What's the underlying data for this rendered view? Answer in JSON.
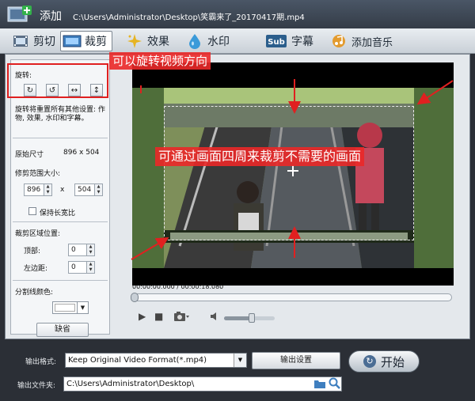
{
  "app": {
    "title": "添加",
    "file_path": "C:\\Users\\Administrator\\Desktop\\笑霸来了_20170417期.mp4"
  },
  "toolbar": {
    "cut": "剪切",
    "crop": "裁剪",
    "effect": "效果",
    "watermark": "水印",
    "subtitle": "字幕",
    "add_music": "添加音乐"
  },
  "left_panel": {
    "rotate_label": "旋转:",
    "rotate_note": "旋转将重置所有其他设置: 作物, 效果, 水印和字幕。",
    "original_size_label": "原始尺寸",
    "original_size_value": "896 x 504",
    "crop_size_label": "修剪范围大小:",
    "crop_width": "896",
    "crop_x": "x",
    "crop_height": "504",
    "keep_ratio": "保持长宽比",
    "crop_pos_label": "裁剪区域位置:",
    "top_label": "顶部:",
    "top_value": "0",
    "left_label": "左边距:",
    "left_value": "0",
    "divider_color_label": "分割线颜色:",
    "default_button": "缺省"
  },
  "player": {
    "time": "00:00:00.000 / 00:00:18.080",
    "seek_progress": 0,
    "volume": 0.55
  },
  "annotations": {
    "rotate_tip": "可以旋转视频方向",
    "crop_tip": "可通过画面四周来裁剪不需要的画面"
  },
  "output": {
    "format_label": "输出格式:",
    "format_value": "Keep Original Video Format(*.mp4)",
    "settings_button": "输出设置",
    "start_button": "开始",
    "folder_label": "输出文件夹:",
    "folder_value": "C:\\Users\\Administrator\\Desktop\\"
  },
  "colors": {
    "annotation_red": "#e02020",
    "title_bar": "#3f4a57",
    "background": "#2b2f36"
  }
}
